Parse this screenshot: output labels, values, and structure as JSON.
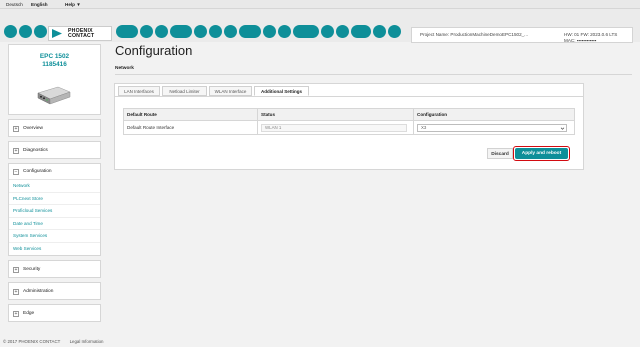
{
  "top_menu": {
    "lang_de": "Deutsch",
    "lang_en": "English",
    "help": "Help ▼"
  },
  "brand": {
    "logo_line1": "PHOENIX",
    "logo_line2": "CONTACT",
    "accent_color": "#0e8f99"
  },
  "project": {
    "name": "Project Name: ProductionMachineDemoEPC1502_...",
    "hw_fw": "HW: 01 FW: 2023.0.6 LTS",
    "mac": "MAC: ▪▪▪▪▪▪▪▪▪▪▪▪"
  },
  "device": {
    "model": "EPC 1502",
    "serial": "1185416"
  },
  "sidebar": {
    "groups_top": [
      {
        "label": "Overview",
        "sign": "+"
      },
      {
        "label": "Diagnostics",
        "sign": "+"
      }
    ],
    "config": {
      "label": "Configuration",
      "sign": "−",
      "items": [
        "Network",
        "PLCnext Store",
        "Proficloud Services",
        "Date and Time",
        "System Services",
        "Web Services"
      ]
    },
    "groups_bottom": [
      {
        "label": "Security",
        "sign": "+"
      },
      {
        "label": "Administration",
        "sign": "+"
      },
      {
        "label": "Edge",
        "sign": "+"
      }
    ]
  },
  "main": {
    "title": "Configuration",
    "section": "Network",
    "tabs": [
      "LAN Interfaces",
      "Netload Limiter",
      "WLAN Interface",
      "Additional Settings"
    ],
    "active_tab": "Additional Settings",
    "table": {
      "headers": [
        "Default Route",
        "Status",
        "Configuration"
      ],
      "row": {
        "name": "Default Route Interface",
        "status": "WLAN 1",
        "config": "X3"
      }
    },
    "buttons": {
      "discard": "Discard",
      "apply": "Apply and reboot"
    }
  },
  "footer": {
    "copyright": "© 2017 PHOENIX CONTACT",
    "legal": "Legal Information"
  }
}
